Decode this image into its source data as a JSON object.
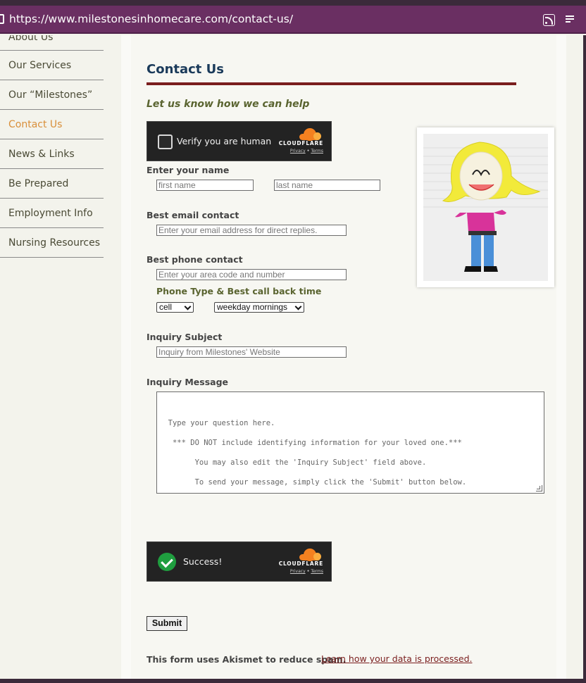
{
  "browser": {
    "url": "https://www.milestonesinhomecare.com/contact-us/"
  },
  "sidebar": {
    "items": [
      {
        "label": "About Us"
      },
      {
        "label": "Our Services"
      },
      {
        "label": "Our “Milestones”"
      },
      {
        "label": "Contact Us",
        "active": true
      },
      {
        "label": "News & Links"
      },
      {
        "label": "Be Prepared"
      },
      {
        "label": "Employment Info"
      },
      {
        "label": "Nursing Resources"
      }
    ]
  },
  "page": {
    "title": "Contact Us",
    "subtitle": "Let us know how we can help"
  },
  "captcha": {
    "verify_label": "Verify you are human",
    "success_label": "Success!",
    "brand": "CLOUDFLARE",
    "privacy": "Privacy",
    "separator": "•",
    "terms": "Terms"
  },
  "form": {
    "name_label": "Enter your name",
    "first_name_placeholder": "first name",
    "last_name_placeholder": "last name",
    "email_label": "Best email contact",
    "email_placeholder": "Enter your email address for direct replies.",
    "phone_label": "Best phone contact",
    "phone_placeholder": "Enter your area code and number",
    "phone_type_label": "Phone Type & Best call back time",
    "phone_type_value": "cell",
    "callback_value": "weekday mornings",
    "subject_label": "Inquiry Subject",
    "subject_placeholder": "Inquiry from Milestones' Website",
    "message_label": "Inquiry Message",
    "message_placeholder": "Type your question here.\n   *** DO NOT include identifying information for your loved one.***\n        You may also edit the 'Inquiry Subject' field above.\n        To send your message, simply click the 'Submit' button below.",
    "submit_label": "Submit"
  },
  "footer": {
    "akismet_text": "This form uses Akismet to reduce spam.",
    "akismet_link": "Learn how your data is processed."
  },
  "colors": {
    "url_bar": "#6a2f62",
    "title": "#1a3a5a",
    "rule": "#7a1e1e",
    "accent_green": "#5a6430",
    "active_nav": "#d98f3a",
    "cloudflare_orange": "#f48120"
  }
}
